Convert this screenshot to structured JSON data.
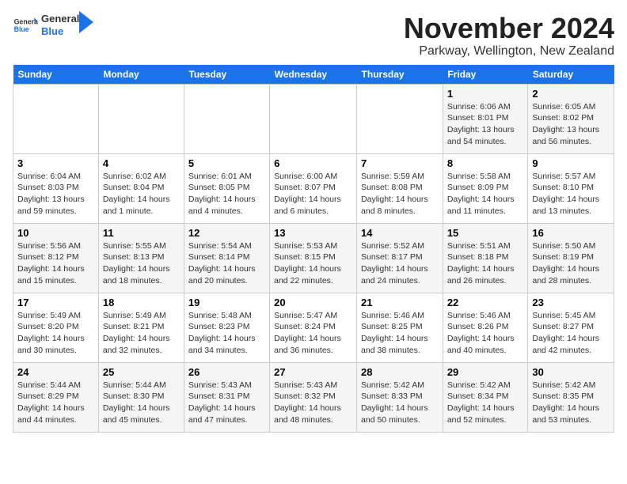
{
  "header": {
    "logo_general": "General",
    "logo_blue": "Blue",
    "month_year": "November 2024",
    "location": "Parkway, Wellington, New Zealand"
  },
  "days_of_week": [
    "Sunday",
    "Monday",
    "Tuesday",
    "Wednesday",
    "Thursday",
    "Friday",
    "Saturday"
  ],
  "weeks": [
    [
      {
        "day": "",
        "info": ""
      },
      {
        "day": "",
        "info": ""
      },
      {
        "day": "",
        "info": ""
      },
      {
        "day": "",
        "info": ""
      },
      {
        "day": "",
        "info": ""
      },
      {
        "day": "1",
        "info": "Sunrise: 6:06 AM\nSunset: 8:01 PM\nDaylight: 13 hours and 54 minutes."
      },
      {
        "day": "2",
        "info": "Sunrise: 6:05 AM\nSunset: 8:02 PM\nDaylight: 13 hours and 56 minutes."
      }
    ],
    [
      {
        "day": "3",
        "info": "Sunrise: 6:04 AM\nSunset: 8:03 PM\nDaylight: 13 hours and 59 minutes."
      },
      {
        "day": "4",
        "info": "Sunrise: 6:02 AM\nSunset: 8:04 PM\nDaylight: 14 hours and 1 minute."
      },
      {
        "day": "5",
        "info": "Sunrise: 6:01 AM\nSunset: 8:05 PM\nDaylight: 14 hours and 4 minutes."
      },
      {
        "day": "6",
        "info": "Sunrise: 6:00 AM\nSunset: 8:07 PM\nDaylight: 14 hours and 6 minutes."
      },
      {
        "day": "7",
        "info": "Sunrise: 5:59 AM\nSunset: 8:08 PM\nDaylight: 14 hours and 8 minutes."
      },
      {
        "day": "8",
        "info": "Sunrise: 5:58 AM\nSunset: 8:09 PM\nDaylight: 14 hours and 11 minutes."
      },
      {
        "day": "9",
        "info": "Sunrise: 5:57 AM\nSunset: 8:10 PM\nDaylight: 14 hours and 13 minutes."
      }
    ],
    [
      {
        "day": "10",
        "info": "Sunrise: 5:56 AM\nSunset: 8:12 PM\nDaylight: 14 hours and 15 minutes."
      },
      {
        "day": "11",
        "info": "Sunrise: 5:55 AM\nSunset: 8:13 PM\nDaylight: 14 hours and 18 minutes."
      },
      {
        "day": "12",
        "info": "Sunrise: 5:54 AM\nSunset: 8:14 PM\nDaylight: 14 hours and 20 minutes."
      },
      {
        "day": "13",
        "info": "Sunrise: 5:53 AM\nSunset: 8:15 PM\nDaylight: 14 hours and 22 minutes."
      },
      {
        "day": "14",
        "info": "Sunrise: 5:52 AM\nSunset: 8:17 PM\nDaylight: 14 hours and 24 minutes."
      },
      {
        "day": "15",
        "info": "Sunrise: 5:51 AM\nSunset: 8:18 PM\nDaylight: 14 hours and 26 minutes."
      },
      {
        "day": "16",
        "info": "Sunrise: 5:50 AM\nSunset: 8:19 PM\nDaylight: 14 hours and 28 minutes."
      }
    ],
    [
      {
        "day": "17",
        "info": "Sunrise: 5:49 AM\nSunset: 8:20 PM\nDaylight: 14 hours and 30 minutes."
      },
      {
        "day": "18",
        "info": "Sunrise: 5:49 AM\nSunset: 8:21 PM\nDaylight: 14 hours and 32 minutes."
      },
      {
        "day": "19",
        "info": "Sunrise: 5:48 AM\nSunset: 8:23 PM\nDaylight: 14 hours and 34 minutes."
      },
      {
        "day": "20",
        "info": "Sunrise: 5:47 AM\nSunset: 8:24 PM\nDaylight: 14 hours and 36 minutes."
      },
      {
        "day": "21",
        "info": "Sunrise: 5:46 AM\nSunset: 8:25 PM\nDaylight: 14 hours and 38 minutes."
      },
      {
        "day": "22",
        "info": "Sunrise: 5:46 AM\nSunset: 8:26 PM\nDaylight: 14 hours and 40 minutes."
      },
      {
        "day": "23",
        "info": "Sunrise: 5:45 AM\nSunset: 8:27 PM\nDaylight: 14 hours and 42 minutes."
      }
    ],
    [
      {
        "day": "24",
        "info": "Sunrise: 5:44 AM\nSunset: 8:29 PM\nDaylight: 14 hours and 44 minutes."
      },
      {
        "day": "25",
        "info": "Sunrise: 5:44 AM\nSunset: 8:30 PM\nDaylight: 14 hours and 45 minutes."
      },
      {
        "day": "26",
        "info": "Sunrise: 5:43 AM\nSunset: 8:31 PM\nDaylight: 14 hours and 47 minutes."
      },
      {
        "day": "27",
        "info": "Sunrise: 5:43 AM\nSunset: 8:32 PM\nDaylight: 14 hours and 48 minutes."
      },
      {
        "day": "28",
        "info": "Sunrise: 5:42 AM\nSunset: 8:33 PM\nDaylight: 14 hours and 50 minutes."
      },
      {
        "day": "29",
        "info": "Sunrise: 5:42 AM\nSunset: 8:34 PM\nDaylight: 14 hours and 52 minutes."
      },
      {
        "day": "30",
        "info": "Sunrise: 5:42 AM\nSunset: 8:35 PM\nDaylight: 14 hours and 53 minutes."
      }
    ]
  ]
}
